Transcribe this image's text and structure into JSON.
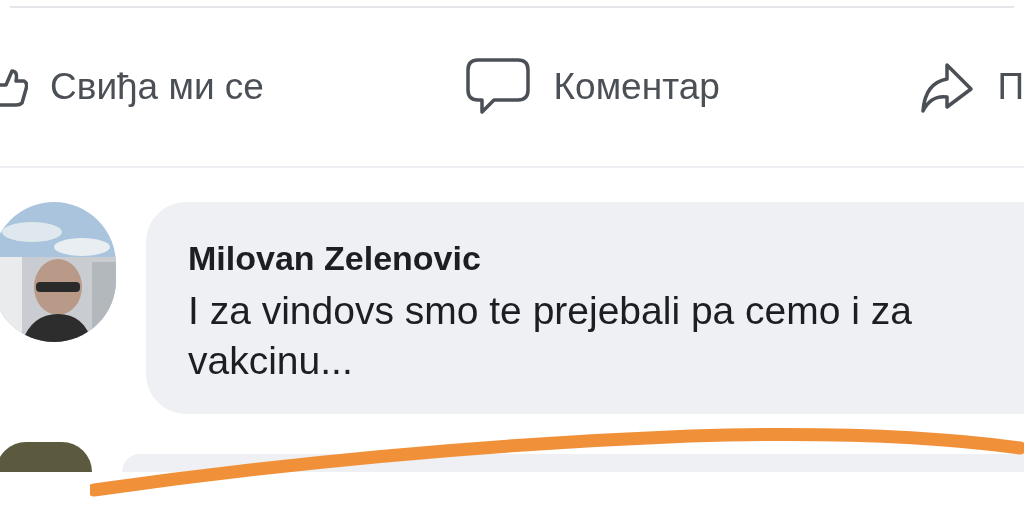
{
  "actions": [
    {
      "kind": "like",
      "label": "Свиђа ми се"
    },
    {
      "kind": "comment",
      "label": "Коментар"
    },
    {
      "kind": "share",
      "label": "П"
    }
  ],
  "comments": [
    {
      "author": "Milovan Zelenovic",
      "text": "I za vindovs smo te prejebali pa cemo i za vakcinu..."
    }
  ]
}
